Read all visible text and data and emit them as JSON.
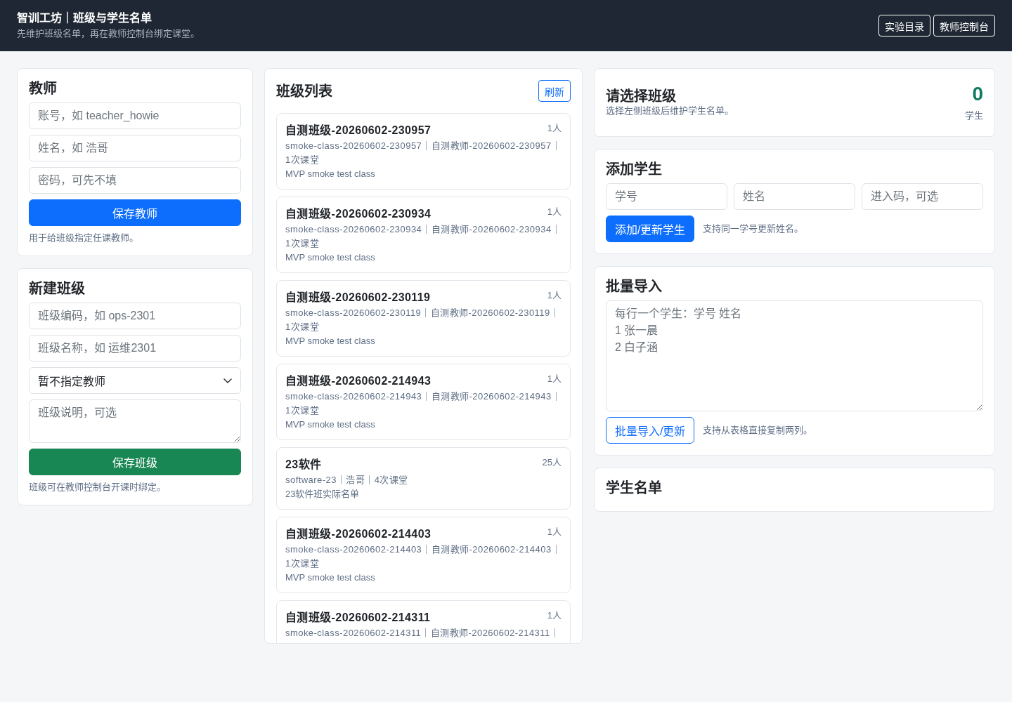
{
  "header": {
    "title": "智训工坊｜班级与学生名单",
    "subtitle": "先维护班级名单，再在教师控制台绑定课堂。",
    "links": [
      "实验目录",
      "教师控制台"
    ]
  },
  "teacher_form": {
    "title": "教师",
    "fields": [
      {
        "placeholder": "账号，如 teacher_howie"
      },
      {
        "placeholder": "姓名，如 浩哥"
      },
      {
        "placeholder": "密码，可先不填"
      }
    ],
    "button": "保存教师",
    "hint": "用于给班级指定任课教师。"
  },
  "class_form": {
    "title": "新建班级",
    "fields": [
      {
        "kind": "input",
        "placeholder": "班级编码，如 ops-2301"
      },
      {
        "kind": "input",
        "placeholder": "班级名称，如 运维2301"
      },
      {
        "kind": "select",
        "value": "暂不指定教师"
      },
      {
        "kind": "textarea",
        "placeholder": "班级说明，可选"
      }
    ],
    "button": "保存班级",
    "hint": "班级可在教师控制台开课时绑定。"
  },
  "class_list": {
    "title": "班级列表",
    "refresh_button": "刷新",
    "classes": [
      {
        "name": "自测班级-20260602-230957",
        "count": "1人",
        "meta": "smoke-class-20260602-230957｜自测教师-20260602-230957｜1次课堂",
        "description": "MVP smoke test class"
      },
      {
        "name": "自测班级-20260602-230934",
        "count": "1人",
        "meta": "smoke-class-20260602-230934｜自测教师-20260602-230934｜1次课堂",
        "description": "MVP smoke test class"
      },
      {
        "name": "自测班级-20260602-230119",
        "count": "1人",
        "meta": "smoke-class-20260602-230119｜自测教师-20260602-230119｜1次课堂",
        "description": "MVP smoke test class"
      },
      {
        "name": "自测班级-20260602-214943",
        "count": "1人",
        "meta": "smoke-class-20260602-214943｜自测教师-20260602-214943｜1次课堂",
        "description": "MVP smoke test class"
      },
      {
        "name": "23软件",
        "count": "25人",
        "meta": "software-23｜浩哥｜4次课堂",
        "description": "23软件班实际名单"
      },
      {
        "name": "自测班级-20260602-214403",
        "count": "1人",
        "meta": "smoke-class-20260602-214403｜自测教师-20260602-214403｜1次课堂",
        "description": "MVP smoke test class"
      },
      {
        "name": "自测班级-20260602-214311",
        "count": "1人",
        "meta": "smoke-class-20260602-214311｜自测教师-20260602-214311｜"
      }
    ]
  },
  "selected_class": {
    "title": "请选择班级",
    "subtitle": "选择左侧班级后维护学生名单。",
    "student_count": "0",
    "count_label": "学生"
  },
  "add_student": {
    "title": "添加学生",
    "fields": [
      {
        "placeholder": "学号"
      },
      {
        "placeholder": "姓名"
      },
      {
        "placeholder": "进入码，可选"
      }
    ],
    "button": "添加/更新学生",
    "hint": "支持同一学号更新姓名。"
  },
  "bulk_import": {
    "title": "批量导入",
    "placeholder": "每行一个学生：学号 姓名\n1 张一晨\n2 白子涵",
    "button": "批量导入/更新",
    "hint": "支持从表格直接复制两列。"
  },
  "roster": {
    "title": "学生名单"
  }
}
